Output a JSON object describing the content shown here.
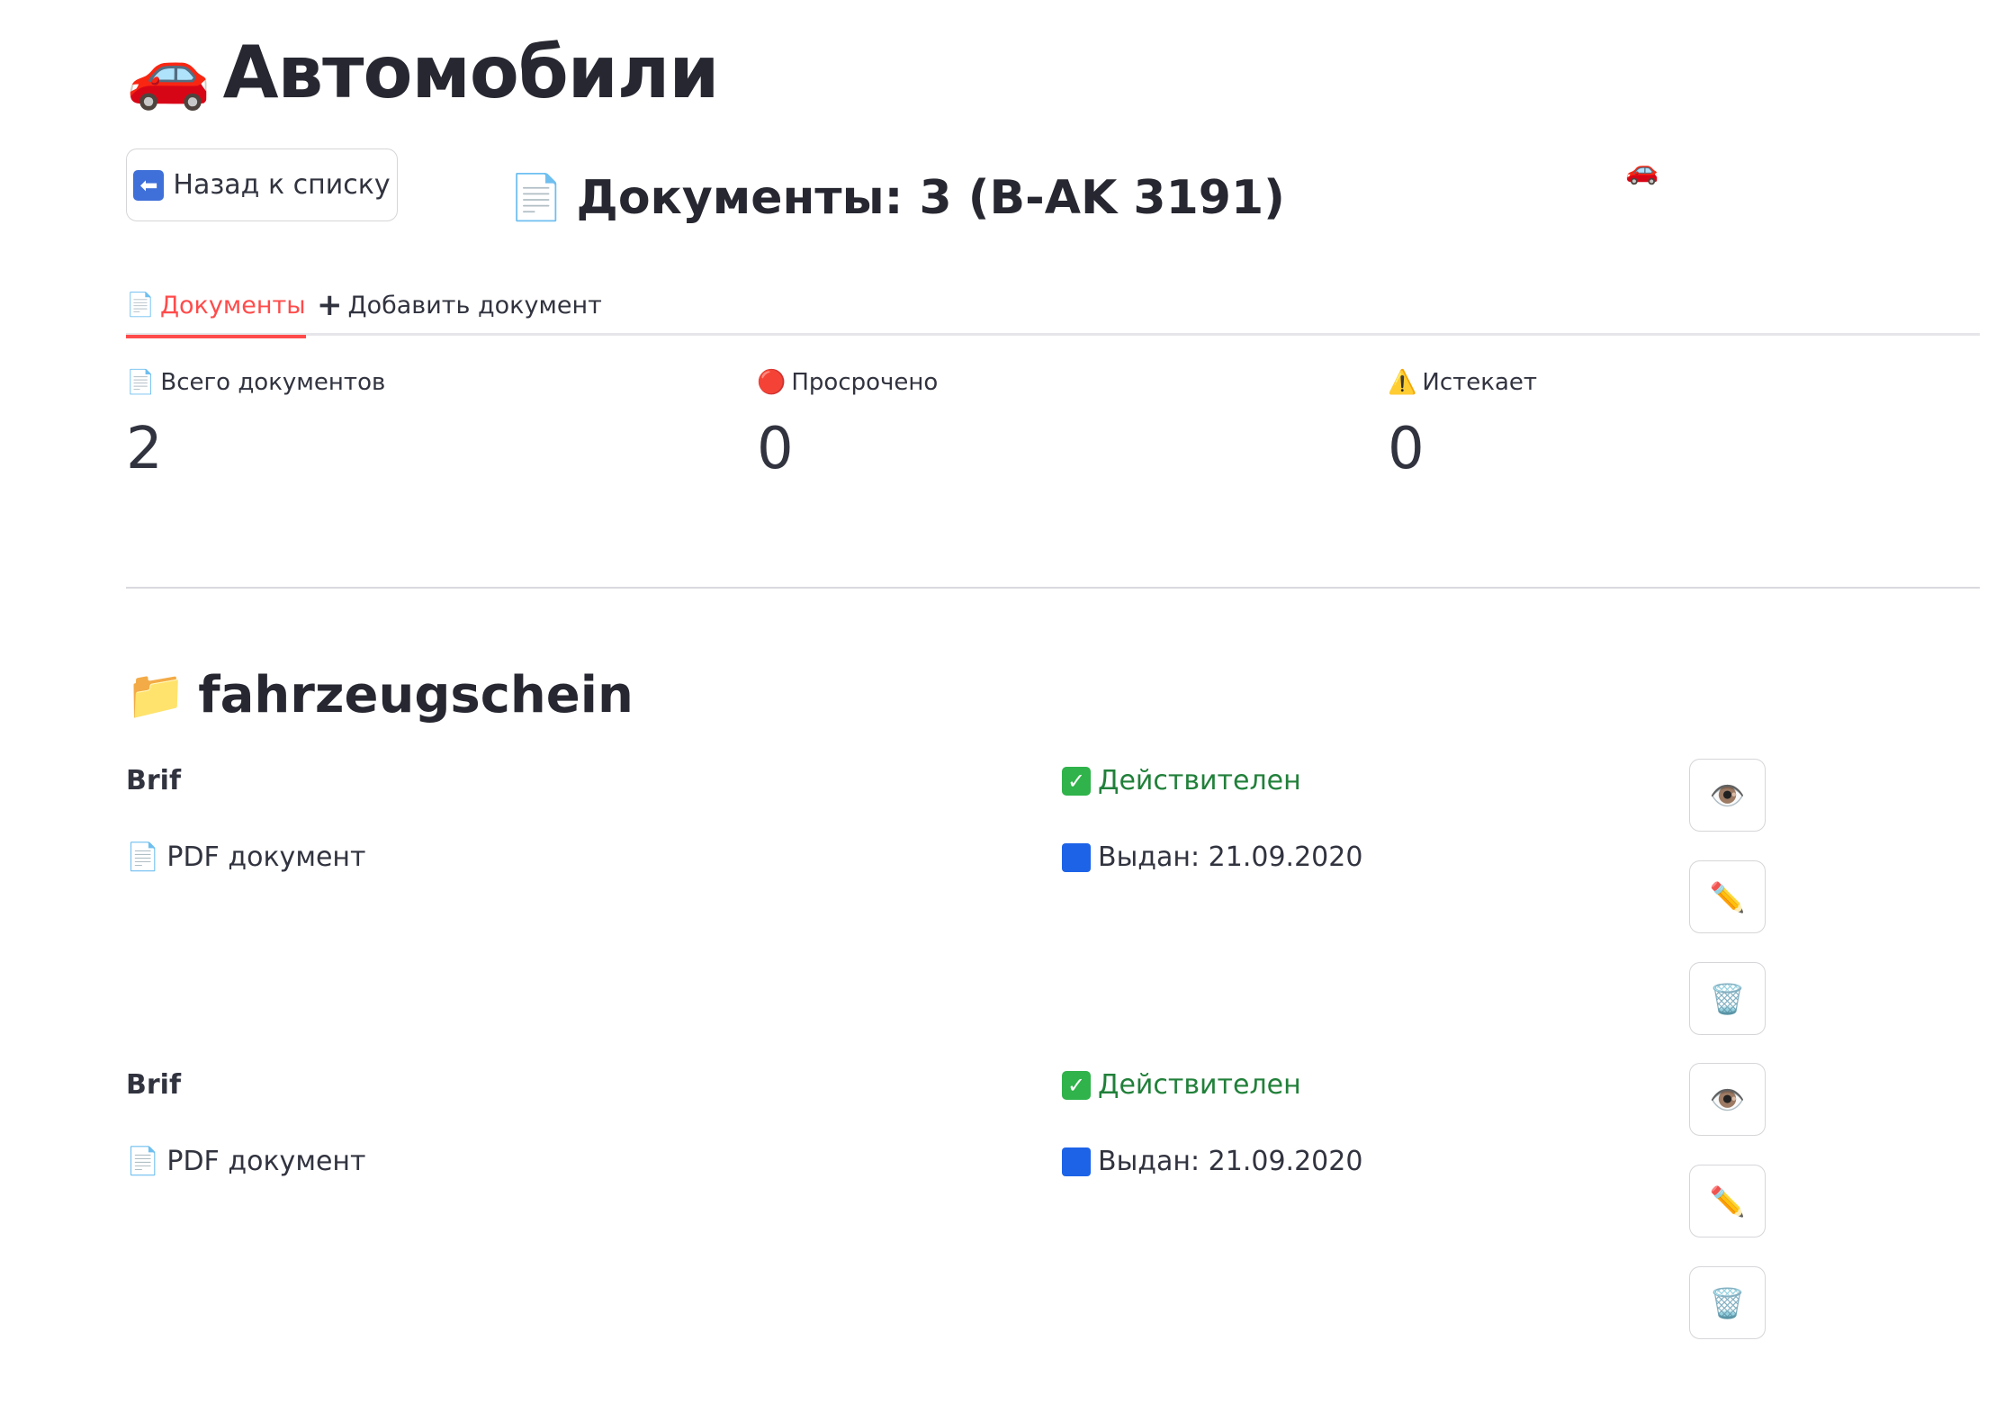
{
  "header": {
    "icon": "🚗",
    "title": "Автомобили"
  },
  "back_button": {
    "icon": "⬅",
    "label": "Назад к списку"
  },
  "documents_heading": {
    "icon": "📄",
    "text": "Документы: 3 (B-AK 3191)"
  },
  "car_icon_small": "🚗",
  "tabs": [
    {
      "icon": "📄",
      "label": "Документы",
      "active": true
    },
    {
      "icon": "+",
      "label": "Добавить документ",
      "active": false
    }
  ],
  "metrics": [
    {
      "icon": "📄",
      "label": "Всего документов",
      "value": "2"
    },
    {
      "icon": "🔴",
      "label": "Просрочено",
      "value": "0"
    },
    {
      "icon": "⚠️",
      "label": "Истекает",
      "value": "0"
    }
  ],
  "section": {
    "icon": "📁",
    "title": "fahrzeugschein"
  },
  "documents": [
    {
      "name": "Brif",
      "type_icon": "📄",
      "type": "PDF документ",
      "status": "Действителен",
      "issued": "Выдан: 21.09.2020"
    },
    {
      "name": "Brif",
      "type_icon": "📄",
      "type": "PDF документ",
      "status": "Действителен",
      "issued": "Выдан: 21.09.2020"
    }
  ],
  "action_icons": {
    "view": "👁️",
    "edit": "✏️",
    "delete": "🗑️"
  },
  "colors": {
    "accent": "#ff4b4b",
    "valid": "#21803a",
    "issued_marker": "#1c63e8"
  }
}
